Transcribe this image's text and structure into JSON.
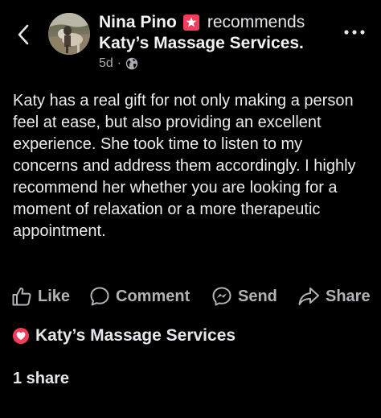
{
  "header": {
    "author": "Nina Pino",
    "verb": "recommends",
    "business": "Katy’s Massage Services.",
    "time": "5d",
    "separator": "·",
    "privacy_icon": "globe-icon",
    "back_icon": "chevron-left-icon",
    "more_icon": "more-dots-icon"
  },
  "post": {
    "text": "Katy has a real gift for not only making a person feel at ease, but also providing an excellent experience. She took time to listen to my concerns and address them accordingly. I highly recommend her whether you are looking for a moment of relaxation or a more therapeutic appointment."
  },
  "actions": [
    {
      "label": "Like",
      "icon": "thumbs-up-icon"
    },
    {
      "label": "Comment",
      "icon": "comment-icon"
    },
    {
      "label": "Send",
      "icon": "messenger-icon"
    },
    {
      "label": "Share",
      "icon": "share-icon"
    }
  ],
  "recommendation": {
    "business": "Katy’s Massage Services",
    "icon": "heart-icon"
  },
  "stats": {
    "shares": "1 share"
  },
  "colors": {
    "background": "#000000",
    "text": "#e4e6eb",
    "muted": "#b0b3b8",
    "accent_red": "#f23e5c"
  }
}
